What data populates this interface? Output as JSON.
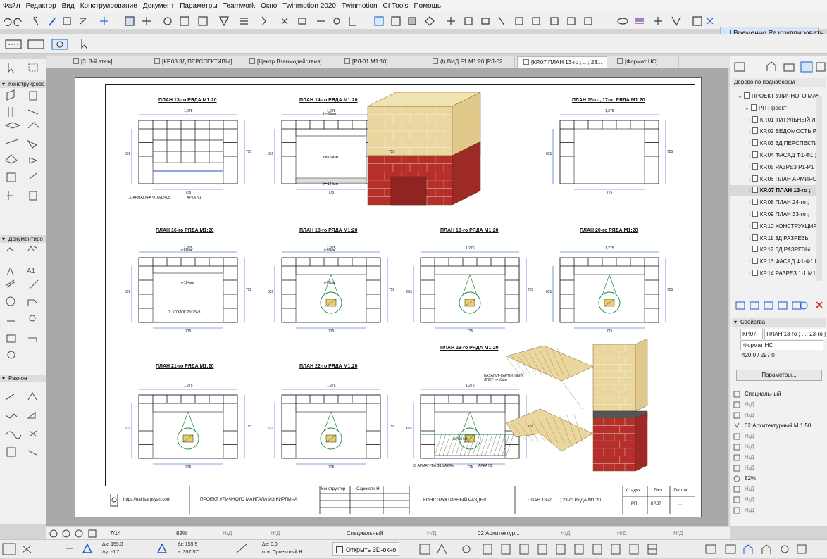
{
  "menu": [
    "Файл",
    "Редактор",
    "Вид",
    "Конструирование",
    "Документ",
    "Параметры",
    "Teamwork",
    "Окно",
    "Twinmotion 2020",
    "Twinmotion",
    "CI Tools",
    "Помощь"
  ],
  "toolbar": {
    "ungroup_label": "Временно Разгруппировать"
  },
  "tabs": [
    {
      "label": "[3. 3-й этаж]",
      "active": false
    },
    {
      "label": "[КР.03 3Д ПЕРСПЕКТИВЫ]",
      "active": false
    },
    {
      "label": "[Центр Взаимодействия]",
      "active": false
    },
    {
      "label": "[РЛ-01 М1:10]",
      "active": false
    },
    {
      "label": "(I) ВИД F1 М1:20 [РЛ-02 ...",
      "active": false
    },
    {
      "label": "[КР.07 ПЛАН 13-го ; ...; 23...",
      "active": true
    },
    {
      "label": "[Формат НС]",
      "active": false
    }
  ],
  "left_groups": [
    "Конструирова",
    "Документиро",
    "Разное"
  ],
  "drawing": {
    "plans": [
      "ПЛАН 13-го РЯДА М1:20",
      "ПЛАН 14-го РЯДА М1:20",
      "ПЛАН 15-го, 17-го РЯДА М1:20",
      "ПЛАН 16-го РЯДА М1:20",
      "ПЛАН 18-го РЯДА М1:20",
      "ПЛАН 19-го РЯДА М1:20",
      "ПЛАН 20-го РЯДА М1:20",
      "ПЛАН 21-го РЯДА М1:20",
      "ПЛАН 22-го РЯДА М1:20",
      "ПЛАН 23-го РЯДА М1:20"
    ],
    "dims": {
      "width": "1,275",
      "inner": "775",
      "height": "755",
      "side": "250",
      "side2": "631"
    },
    "notes": {
      "armature1": "3. АРМАТУРА Ф16/А240с",
      "arka1": "АРКА N1",
      "ugolok": "7. УГОЛОК 25х25х3",
      "h65": "h=65мм",
      "h124": "h=124мм",
      "h61": "h=61мм",
      "basalt": "БАЗАЛЬТ-КАРТОННЫЙ ЛИСТ h=10мм",
      "arka3": "АРКА N3",
      "armature2": "3. АРМАТУРА Ф16/А240с",
      "arka2": "АРКА N2"
    },
    "titleblock": {
      "site": "https://nairisargsyan.com",
      "project": "ПРОЕКТ УЛИЧНОГО МАНГАЛА ИЗ КИРПИЧА",
      "role": "Конструктор",
      "person": "Саркисян Н.",
      "section": "КОНСТРУКТИВНЫЙ РАЗДЕЛ",
      "sheet_title": "ПЛАН 13-го ; ...; 23-го РЯДА М1:20",
      "stage_hd": "Стадия",
      "sheet_hd": "Лист",
      "sheets_hd": "Листов",
      "stage": "РП",
      "sheet_no": "КР.07",
      "sheets": "..."
    }
  },
  "navigator": {
    "header": "Дерево по поднаборам",
    "items": [
      {
        "label": "ПРОЕКТ УЛИЧНОГО МАН",
        "level": 0,
        "selected": false
      },
      {
        "label": "РП Проект",
        "level": 1,
        "selected": false
      },
      {
        "label": "КР.01 ТИТУЛЬНЫЙ ЛИ",
        "level": 2,
        "selected": false
      },
      {
        "label": "КР.02 ВЕДОМОСТЬ РА",
        "level": 2,
        "selected": false
      },
      {
        "label": "КР.03 3Д ПЕРСПЕКТИ",
        "level": 2,
        "selected": false
      },
      {
        "label": "КР.04 ФАСАД Ф1-Ф1 ;",
        "level": 2,
        "selected": false
      },
      {
        "label": "КР.05 РАЗРЕЗ Р1-Р1 М",
        "level": 2,
        "selected": false
      },
      {
        "label": "КР.06 ПЛАН АРМИРО",
        "level": 2,
        "selected": false
      },
      {
        "label": "КР.07 ПЛАН 13-го ;",
        "level": 2,
        "selected": true
      },
      {
        "label": "КР.08 ПЛАН 24-го ;",
        "level": 2,
        "selected": false
      },
      {
        "label": "КР.09 ПЛАН 33-го ;",
        "level": 2,
        "selected": false
      },
      {
        "label": "КР.10 КОНСТРУКЦИЯ",
        "level": 2,
        "selected": false
      },
      {
        "label": "КР.11 3Д РАЗРЕЗЫ",
        "level": 2,
        "selected": false
      },
      {
        "label": "КР.12 3Д РАЗРЕЗЫ",
        "level": 2,
        "selected": false
      },
      {
        "label": "КР.13 ФАСАД Ф1-Ф1 М",
        "level": 2,
        "selected": false
      },
      {
        "label": "КР.14 РАЗРЕЗ 1-1 М1:",
        "level": 2,
        "selected": false
      }
    ]
  },
  "properties": {
    "header": "Свойства",
    "id": "КР.07",
    "name": "ПЛАН 13-го ; ...; 23-го |",
    "format": "Формат НС",
    "size": "420.0 / 297.0",
    "params_button": "Параметры...",
    "special": "Специальный",
    "nd": "Н/Д",
    "layer": "02 Архитектурный М 1:50",
    "zoom": "82%"
  },
  "status": {
    "page": "7/14",
    "zoom": "82%",
    "nd": "Н/Д",
    "special": "Специальный",
    "arch": "02 Архитектур...",
    "nd2": "Н/Д"
  },
  "bottom": {
    "dx": "Δx: 159.3",
    "dy": "Δy: -6.7",
    "dr": "Δr: 159.5",
    "da": "a: 357.57°",
    "dz": "Δz: 0.0",
    "rel": "отн. Проектный Н...",
    "open3d": "Открыть 3D-окно"
  },
  "colors": {
    "accent": "#1f4fd6",
    "brick_red": "#b5302b",
    "brick_tan": "#ead7a0",
    "leader_green": "#1c8c3a"
  }
}
